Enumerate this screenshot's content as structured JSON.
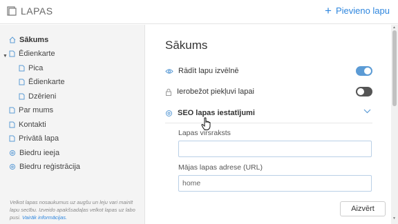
{
  "header": {
    "title": "LAPAS",
    "add_page_label": "Pievieno lapu"
  },
  "sidebar": {
    "items": [
      {
        "label": "Sākums",
        "icon": "home-icon"
      },
      {
        "label": "Ēdienkarte",
        "icon": "page-icon"
      },
      {
        "label": "Pica",
        "icon": "page-icon"
      },
      {
        "label": "Ēdienkarte",
        "icon": "page-icon"
      },
      {
        "label": "Dzērieni",
        "icon": "page-icon"
      },
      {
        "label": "Par mums",
        "icon": "page-icon"
      },
      {
        "label": "Kontakti",
        "icon": "page-icon"
      },
      {
        "label": "Privātā lapa",
        "icon": "page-icon"
      },
      {
        "label": "Biedru ieeja",
        "icon": "gear-icon"
      },
      {
        "label": "Biedru reģistrācija",
        "icon": "gear-icon"
      }
    ],
    "hint_text": "Velkot lapas nosaukumus uz augšu un leju vari mainīt lapu secību. Izveido apakšsadaļas velkot lapas uz labo pusi.",
    "hint_link": "Vairāk informācijas."
  },
  "main": {
    "title": "Sākums",
    "show_in_menu_label": "Rādīt lapu izvēlnē",
    "show_in_menu_on": true,
    "restrict_access_label": "Ierobežot piekļuvi lapai",
    "restrict_access_on": false,
    "seo_label": "SEO lapas iestatījumi",
    "page_title_label": "Lapas virsraksts",
    "page_title_value": "",
    "url_label": "Mājas lapas adrese (URL)",
    "url_value": "home",
    "close_label": "Aizvērt"
  },
  "colors": {
    "accent": "#2e86de",
    "toggle_on": "#5b9bd5",
    "toggle_off": "#555555",
    "sidebar_bg": "#f4f4f4"
  }
}
